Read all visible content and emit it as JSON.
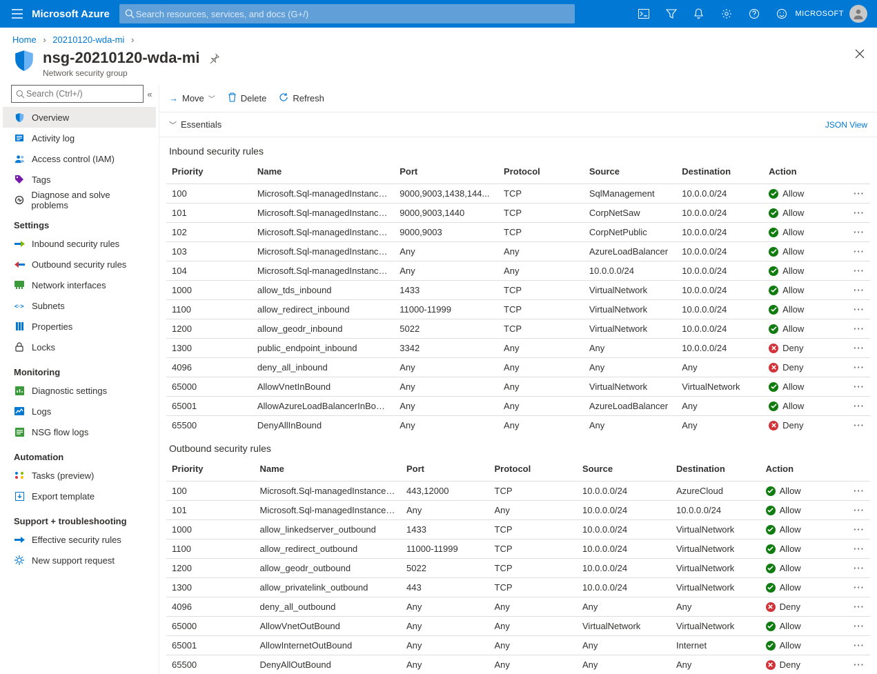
{
  "brand": "Microsoft Azure",
  "search_placeholder": "Search resources, services, and docs (G+/)",
  "account_label": "MICROSOFT",
  "crumbs": {
    "home": "Home",
    "parent": "20210120-wda-mi"
  },
  "title": "nsg-20210120-wda-mi",
  "subtitle": "Network security group",
  "side_search_placeholder": "Search (Ctrl+/)",
  "sections": {
    "top": [
      {
        "label": "Overview"
      },
      {
        "label": "Activity log"
      },
      {
        "label": "Access control (IAM)"
      },
      {
        "label": "Tags"
      },
      {
        "label": "Diagnose and solve problems"
      }
    ],
    "settings_label": "Settings",
    "settings": [
      {
        "label": "Inbound security rules"
      },
      {
        "label": "Outbound security rules"
      },
      {
        "label": "Network interfaces"
      },
      {
        "label": "Subnets"
      },
      {
        "label": "Properties"
      },
      {
        "label": "Locks"
      }
    ],
    "monitoring_label": "Monitoring",
    "monitoring": [
      {
        "label": "Diagnostic settings"
      },
      {
        "label": "Logs"
      },
      {
        "label": "NSG flow logs"
      }
    ],
    "automation_label": "Automation",
    "automation": [
      {
        "label": "Tasks (preview)"
      },
      {
        "label": "Export template"
      }
    ],
    "support_label": "Support + troubleshooting",
    "support": [
      {
        "label": "Effective security rules"
      },
      {
        "label": "New support request"
      }
    ]
  },
  "commands": {
    "move": "Move",
    "delete": "Delete",
    "refresh": "Refresh"
  },
  "essentials_label": "Essentials",
  "json_view": "JSON View",
  "inbound_title": "Inbound security rules",
  "outbound_title": "Outbound security rules",
  "columns": {
    "priority": "Priority",
    "name": "Name",
    "port": "Port",
    "protocol": "Protocol",
    "source": "Source",
    "destination": "Destination",
    "action": "Action"
  },
  "inbound": [
    {
      "priority": "100",
      "name": "Microsoft.Sql-managedInstances_U...",
      "port": "9000,9003,1438,144...",
      "protocol": "TCP",
      "source": "SqlManagement",
      "destination": "10.0.0.0/24",
      "action": "Allow"
    },
    {
      "priority": "101",
      "name": "Microsoft.Sql-managedInstances_U...",
      "port": "9000,9003,1440",
      "protocol": "TCP",
      "source": "CorpNetSaw",
      "destination": "10.0.0.0/24",
      "action": "Allow"
    },
    {
      "priority": "102",
      "name": "Microsoft.Sql-managedInstances_U...",
      "port": "9000,9003",
      "protocol": "TCP",
      "source": "CorpNetPublic",
      "destination": "10.0.0.0/24",
      "action": "Allow"
    },
    {
      "priority": "103",
      "name": "Microsoft.Sql-managedInstances_U...",
      "port": "Any",
      "protocol": "Any",
      "source": "AzureLoadBalancer",
      "destination": "10.0.0.0/24",
      "action": "Allow"
    },
    {
      "priority": "104",
      "name": "Microsoft.Sql-managedInstances_U...",
      "port": "Any",
      "protocol": "Any",
      "source": "10.0.0.0/24",
      "destination": "10.0.0.0/24",
      "action": "Allow"
    },
    {
      "priority": "1000",
      "name": "allow_tds_inbound",
      "port": "1433",
      "protocol": "TCP",
      "source": "VirtualNetwork",
      "destination": "10.0.0.0/24",
      "action": "Allow"
    },
    {
      "priority": "1100",
      "name": "allow_redirect_inbound",
      "port": "11000-11999",
      "protocol": "TCP",
      "source": "VirtualNetwork",
      "destination": "10.0.0.0/24",
      "action": "Allow"
    },
    {
      "priority": "1200",
      "name": "allow_geodr_inbound",
      "port": "5022",
      "protocol": "TCP",
      "source": "VirtualNetwork",
      "destination": "10.0.0.0/24",
      "action": "Allow"
    },
    {
      "priority": "1300",
      "name": "public_endpoint_inbound",
      "port": "3342",
      "protocol": "Any",
      "source": "Any",
      "destination": "10.0.0.0/24",
      "action": "Deny"
    },
    {
      "priority": "4096",
      "name": "deny_all_inbound",
      "port": "Any",
      "protocol": "Any",
      "source": "Any",
      "destination": "Any",
      "action": "Deny"
    },
    {
      "priority": "65000",
      "name": "AllowVnetInBound",
      "port": "Any",
      "protocol": "Any",
      "source": "VirtualNetwork",
      "destination": "VirtualNetwork",
      "action": "Allow"
    },
    {
      "priority": "65001",
      "name": "AllowAzureLoadBalancerInBound",
      "port": "Any",
      "protocol": "Any",
      "source": "AzureLoadBalancer",
      "destination": "Any",
      "action": "Allow"
    },
    {
      "priority": "65500",
      "name": "DenyAllInBound",
      "port": "Any",
      "protocol": "Any",
      "source": "Any",
      "destination": "Any",
      "action": "Deny"
    }
  ],
  "outbound": [
    {
      "priority": "100",
      "name": "Microsoft.Sql-managedInstances_U...",
      "port": "443,12000",
      "protocol": "TCP",
      "source": "10.0.0.0/24",
      "destination": "AzureCloud",
      "action": "Allow"
    },
    {
      "priority": "101",
      "name": "Microsoft.Sql-managedInstances_U...",
      "port": "Any",
      "protocol": "Any",
      "source": "10.0.0.0/24",
      "destination": "10.0.0.0/24",
      "action": "Allow"
    },
    {
      "priority": "1000",
      "name": "allow_linkedserver_outbound",
      "port": "1433",
      "protocol": "TCP",
      "source": "10.0.0.0/24",
      "destination": "VirtualNetwork",
      "action": "Allow"
    },
    {
      "priority": "1100",
      "name": "allow_redirect_outbound",
      "port": "11000-11999",
      "protocol": "TCP",
      "source": "10.0.0.0/24",
      "destination": "VirtualNetwork",
      "action": "Allow"
    },
    {
      "priority": "1200",
      "name": "allow_geodr_outbound",
      "port": "5022",
      "protocol": "TCP",
      "source": "10.0.0.0/24",
      "destination": "VirtualNetwork",
      "action": "Allow"
    },
    {
      "priority": "1300",
      "name": "allow_privatelink_outbound",
      "port": "443",
      "protocol": "TCP",
      "source": "10.0.0.0/24",
      "destination": "VirtualNetwork",
      "action": "Allow"
    },
    {
      "priority": "4096",
      "name": "deny_all_outbound",
      "port": "Any",
      "protocol": "Any",
      "source": "Any",
      "destination": "Any",
      "action": "Deny"
    },
    {
      "priority": "65000",
      "name": "AllowVnetOutBound",
      "port": "Any",
      "protocol": "Any",
      "source": "VirtualNetwork",
      "destination": "VirtualNetwork",
      "action": "Allow"
    },
    {
      "priority": "65001",
      "name": "AllowInternetOutBound",
      "port": "Any",
      "protocol": "Any",
      "source": "Any",
      "destination": "Internet",
      "action": "Allow"
    },
    {
      "priority": "65500",
      "name": "DenyAllOutBound",
      "port": "Any",
      "protocol": "Any",
      "source": "Any",
      "destination": "Any",
      "action": "Deny"
    }
  ]
}
